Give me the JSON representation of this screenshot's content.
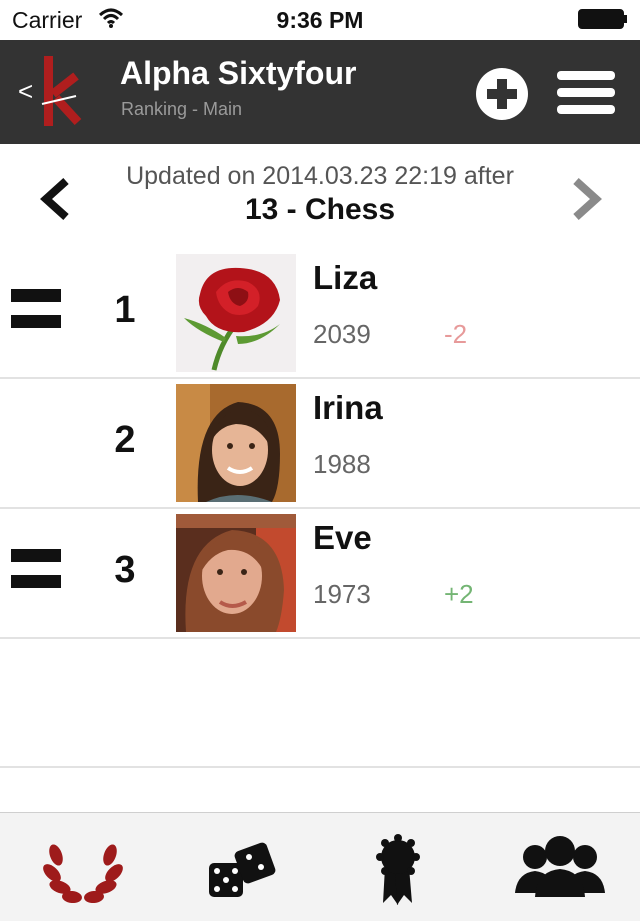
{
  "status_bar": {
    "carrier": "Carrier",
    "time": "9:36 PM"
  },
  "header": {
    "back_label": "<",
    "title": "Alpha Sixtyfour",
    "subtitle": "Ranking - Main"
  },
  "ranking": {
    "updated_text": "Updated on 2014.03.23 22:19 after",
    "group_title": "13 - Chess",
    "entries": [
      {
        "rank": "1",
        "name": "Liza",
        "score": "2039",
        "delta": "-2",
        "trend": "equal",
        "avatar": "rose-photo"
      },
      {
        "rank": "2",
        "name": "Irina",
        "score": "1988",
        "delta": "",
        "trend": "none",
        "avatar": "portrait-photo"
      },
      {
        "rank": "3",
        "name": "Eve",
        "score": "1973",
        "delta": "+2",
        "trend": "equal",
        "avatar": "portrait-photo"
      }
    ]
  },
  "tabs": [
    {
      "icon": "laurel-wreath-icon",
      "active": true
    },
    {
      "icon": "dice-icon",
      "active": false
    },
    {
      "icon": "award-ribbon-icon",
      "active": false
    },
    {
      "icon": "group-icon",
      "active": false
    }
  ],
  "colors": {
    "navbar": "#333333",
    "accent_red": "#b01e1e",
    "delta_negative": "#e79a9a",
    "delta_positive": "#74b574",
    "separator": "#e2e2e2"
  }
}
